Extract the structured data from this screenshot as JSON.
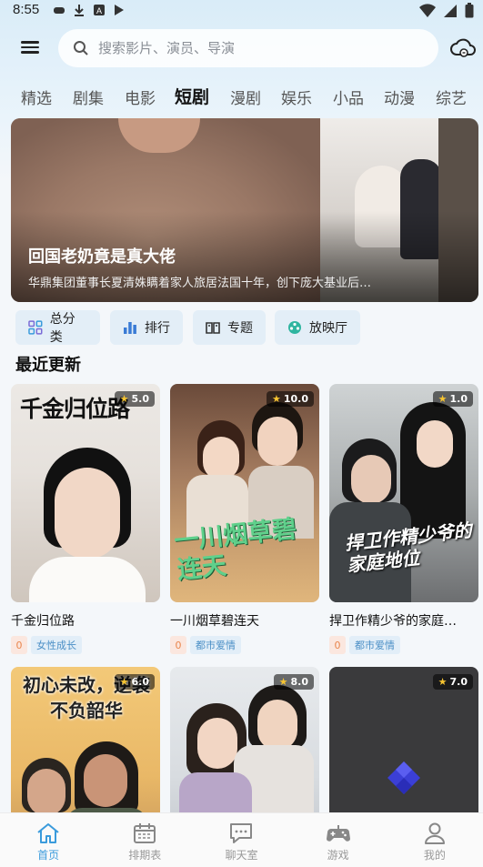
{
  "status_bar": {
    "time": "8:55"
  },
  "search": {
    "placeholder": "搜索影片、演员、导演"
  },
  "tabs": [
    {
      "label": "精选",
      "active": false
    },
    {
      "label": "剧集",
      "active": false
    },
    {
      "label": "电影",
      "active": false
    },
    {
      "label": "短剧",
      "active": true
    },
    {
      "label": "漫剧",
      "active": false
    },
    {
      "label": "娱乐",
      "active": false
    },
    {
      "label": "小品",
      "active": false
    },
    {
      "label": "动漫",
      "active": false
    },
    {
      "label": "综艺",
      "active": false
    }
  ],
  "banner": {
    "title": "回国老奶竟是真大佬",
    "description": "华鼎集团董事长夏清姝瞒着家人旅居法国十年，创下庞大基业后…"
  },
  "quick_links": [
    {
      "label": "总分类",
      "icon": "grid-icon"
    },
    {
      "label": "排行",
      "icon": "bar-chart-icon"
    },
    {
      "label": "专题",
      "icon": "book-icon"
    },
    {
      "label": "放映厅",
      "icon": "film-reel-icon"
    }
  ],
  "section_title": "最近更新",
  "cards": [
    {
      "title": "千金归位路",
      "rating": "5.0",
      "count": "0",
      "genre": "女性成长",
      "poster_text": "千金归位路"
    },
    {
      "title": "一川烟草碧连天",
      "rating": "10.0",
      "count": "0",
      "genre": "都市爱情",
      "poster_text": "一川烟草碧连天"
    },
    {
      "title": "捍卫作精少爷的家庭…",
      "rating": "1.0",
      "count": "0",
      "genre": "都市爱情",
      "poster_text": "捍卫作精少爷的家庭地位"
    },
    {
      "title": "",
      "rating": "6.0",
      "count": "",
      "genre": "",
      "poster_text": "初心未改，逆袭不负韶华"
    },
    {
      "title": "",
      "rating": "8.0",
      "count": "",
      "genre": "",
      "poster_text": ""
    },
    {
      "title": "",
      "rating": "7.0",
      "count": "",
      "genre": "",
      "poster_text": ""
    }
  ],
  "bottom_nav": [
    {
      "label": "首页",
      "icon": "home-icon",
      "active": true
    },
    {
      "label": "排期表",
      "icon": "calendar-icon",
      "active": false
    },
    {
      "label": "聊天室",
      "icon": "chat-icon",
      "active": false
    },
    {
      "label": "游戏",
      "icon": "gamepad-icon",
      "active": false
    },
    {
      "label": "我的",
      "icon": "user-icon",
      "active": false
    }
  ],
  "colors": {
    "accent": "#3a9bdc",
    "tag_genre_text": "#4b8fc6",
    "tag_count_text": "#e9864e",
    "star": "#f6c431"
  }
}
